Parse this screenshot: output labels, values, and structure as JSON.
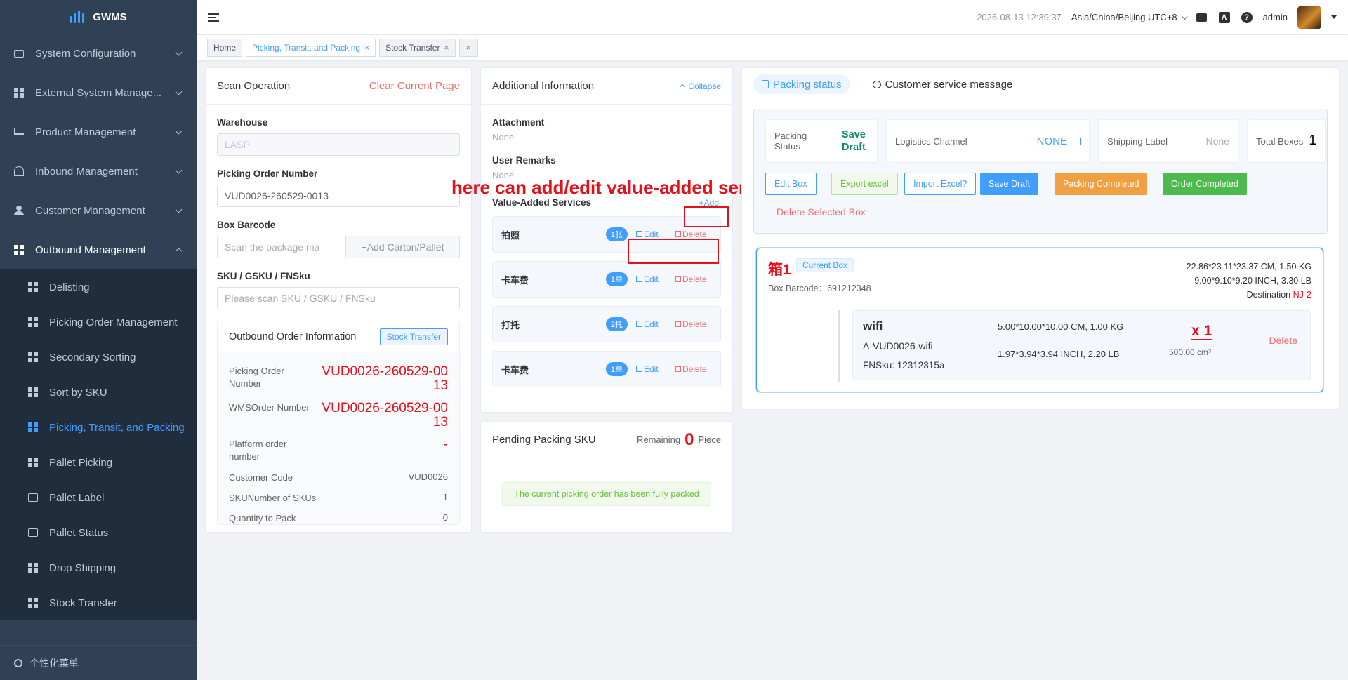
{
  "app": {
    "logo": "GWMS"
  },
  "sidebar": {
    "menu": [
      {
        "label": "System Configuration"
      },
      {
        "label": "External System Manage..."
      },
      {
        "label": "Product Management"
      },
      {
        "label": "Inbound Management"
      },
      {
        "label": "Customer Management"
      },
      {
        "label": "Outbound Management"
      }
    ],
    "submenu": [
      {
        "label": "Delisting"
      },
      {
        "label": "Picking Order Management"
      },
      {
        "label": "Secondary Sorting"
      },
      {
        "label": "Sort by SKU"
      },
      {
        "label": "Picking, Transit, and Packing"
      },
      {
        "label": "Pallet Picking"
      },
      {
        "label": "Pallet Label"
      },
      {
        "label": "Pallet Status"
      },
      {
        "label": "Drop Shipping"
      },
      {
        "label": "Stock Transfer"
      }
    ],
    "footer": "个性化菜单"
  },
  "header": {
    "datetime": "2026-08-13 12:39:37",
    "timezone": "Asia/China/Beijing UTC+8",
    "translate_glyph": "A",
    "help_glyph": "?",
    "user": "admin"
  },
  "tags": [
    {
      "label": "Home"
    },
    {
      "label": "Picking, Transit, and Packing"
    },
    {
      "label": "Stock Transfer"
    }
  ],
  "tag_close": "×",
  "scan": {
    "title": "Scan Operation",
    "clear": "Clear Current Page",
    "warehouse_label": "Warehouse",
    "warehouse_value": "LASP",
    "picking_label": "Picking Order Number",
    "picking_value": "VUD0026-260529-0013",
    "box_label": "Box Barcode",
    "box_placeholder": "Scan the package ma",
    "add_carton": "+Add Carton/Pallet",
    "sku_label": "SKU / GSKU / FNSku",
    "sku_placeholder": "Please scan SKU / GSKU / FNSku",
    "outbound": {
      "title": "Outbound Order Information",
      "stock_transfer": "Stock Transfer",
      "rows": [
        {
          "k": "Picking Order Number",
          "v": "VUD0026-260529-0013"
        },
        {
          "k": "WMSOrder Number",
          "v": "VUD0026-260529-0013"
        },
        {
          "k": "Platform order number",
          "v": "-"
        },
        {
          "k": "Customer Code",
          "v": "VUD0026"
        },
        {
          "k": "SKUNumber of SKUs",
          "v": "1"
        },
        {
          "k": "Quantity to Pack",
          "v": "0"
        }
      ]
    }
  },
  "additional": {
    "title": "Additional Information",
    "collapse": "Collapse",
    "attachment_label": "Attachment",
    "attachment_value": "None",
    "remarks_label": "User Remarks",
    "remarks_value": "None",
    "vas_label": "Value-Added Services",
    "vas_add": "+Add",
    "edit": "Edit",
    "delete": "Delete",
    "services": [
      {
        "name": "拍照",
        "badge": "1张"
      },
      {
        "name": "卡车费",
        "badge": "1单"
      },
      {
        "name": "打托",
        "badge": "2托"
      },
      {
        "name": "卡车费",
        "badge": "1单"
      }
    ],
    "annotation": "here can add/edit value-added service"
  },
  "pending": {
    "title": "Pending Packing SKU",
    "remaining": "Remaining",
    "count": "0",
    "unit": "Piece",
    "message": "The current picking order has been fully packed"
  },
  "packing": {
    "tab_status": "Packing status",
    "tab_message": "Customer service message",
    "status_label": "Packing Status",
    "status_value": "Save Draft",
    "channel_label": "Logistics Channel",
    "channel_value": "NONE",
    "label_label": "Shipping Label",
    "label_value": "None",
    "boxes_label": "Total Boxes",
    "boxes_value": "1",
    "buttons": {
      "edit_box": "Edit Box",
      "export": "Export excel",
      "import": "Import Excel?",
      "save": "Save Draft",
      "packing_completed": "Packing Completed",
      "order_completed": "Order Completed",
      "delete_selected": "Delete Selected Box"
    },
    "box": {
      "name": "箱1",
      "current": "Current Box",
      "barcode": "Box Barcode：691212348",
      "dims_cm": "22.86*23.11*23.37 CM, 1.50 KG",
      "dims_inch": "9.00*9.10*9.20 INCH, 3.30 LB",
      "destination_label": "Destination",
      "destination_value": "NJ-2",
      "sku": {
        "name": "wifi",
        "code": "A-VUD0026-wifi",
        "fnsku": "FNSku: 12312315a",
        "dims_cm": "5.00*10.00*10.00 CM, 1.00 KG",
        "dims_inch": "1.97*3.94*3.94 INCH, 2.20 LB",
        "qty": "x 1",
        "volume": "500.00 cm³",
        "delete": "Delete"
      }
    }
  },
  "colors": {
    "primary": "#409eff",
    "danger": "#f56c6c",
    "highlight_red": "#e4101a",
    "success": "#67c23a",
    "warning": "#f0a040",
    "sidebar_bg": "#304156",
    "sidebar_sub_bg": "#1f2d3d"
  }
}
